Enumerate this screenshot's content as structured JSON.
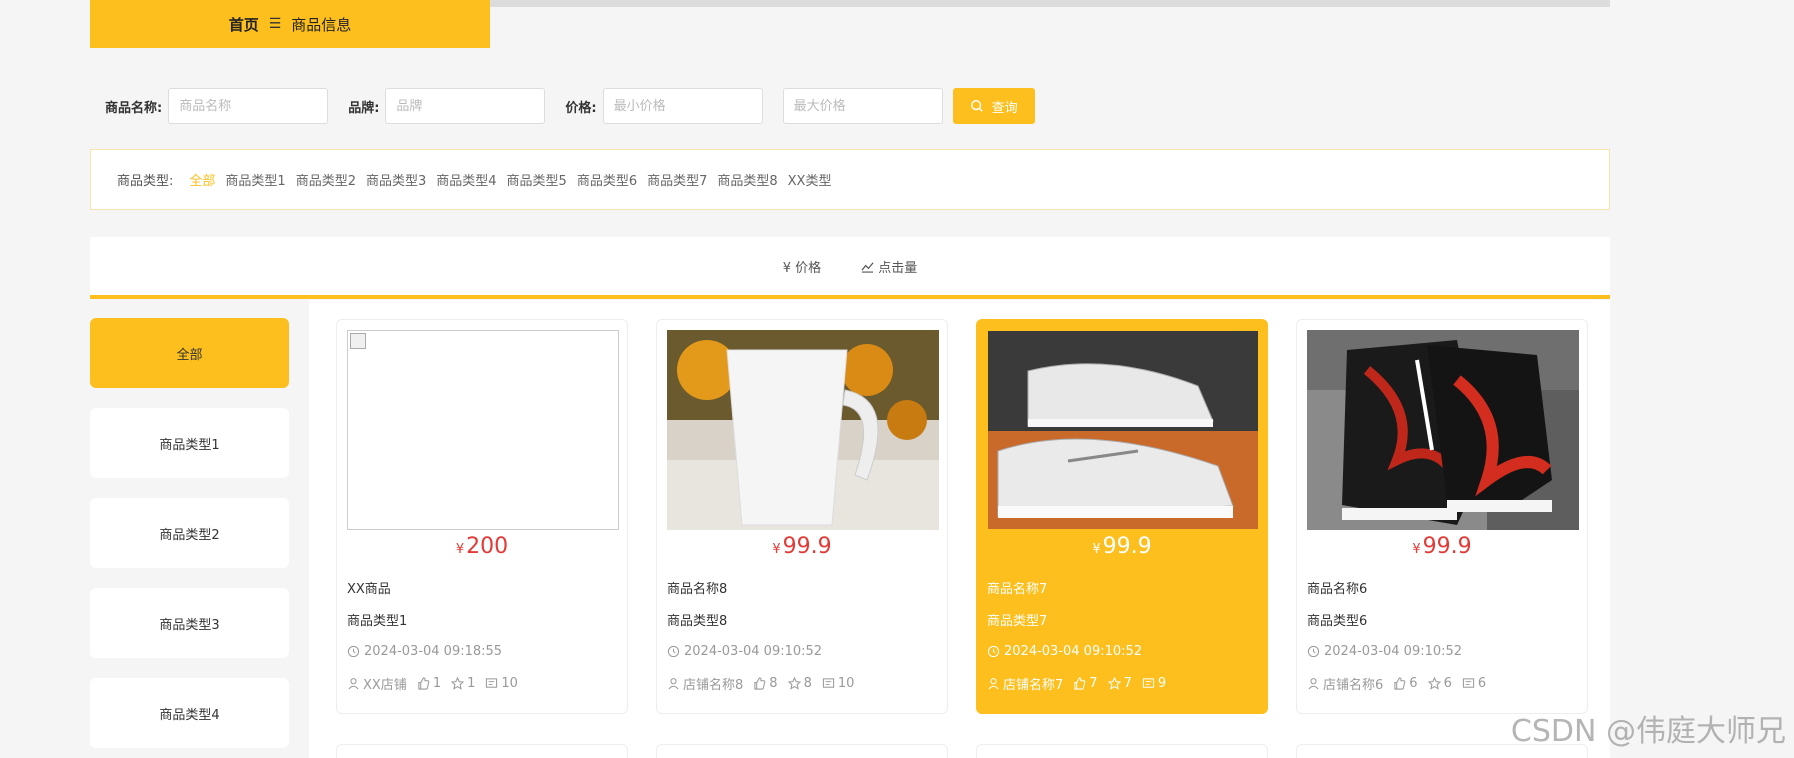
{
  "breadcrumb": {
    "home": "首页",
    "separator": "☰",
    "current": "商品信息"
  },
  "search": {
    "name_label": "商品名称:",
    "name_placeholder": "商品名称",
    "brand_label": "品牌:",
    "brand_placeholder": "品牌",
    "price_label": "价格:",
    "min_placeholder": "最小价格",
    "max_placeholder": "最大价格",
    "button_label": "查询"
  },
  "types": {
    "label": "商品类型:",
    "items": [
      "全部",
      "商品类型1",
      "商品类型2",
      "商品类型3",
      "商品类型4",
      "商品类型5",
      "商品类型6",
      "商品类型7",
      "商品类型8",
      "XX类型"
    ]
  },
  "sort": {
    "price": "¥ 价格",
    "clicks": "点击量"
  },
  "sidebar": {
    "items": [
      "全部",
      "商品类型1",
      "商品类型2",
      "商品类型3",
      "商品类型4"
    ]
  },
  "cards": [
    {
      "price_symbol": "¥",
      "price": "200",
      "name": "XX商品",
      "type": "商品类型1",
      "time": "2024-03-04 09:18:55",
      "shop": "XX店铺",
      "likes": "1",
      "favs": "1",
      "comments": "10"
    },
    {
      "price_symbol": "¥",
      "price": "99.9",
      "name": "商品名称8",
      "type": "商品类型8",
      "time": "2024-03-04 09:10:52",
      "shop": "店铺名称8",
      "likes": "8",
      "favs": "8",
      "comments": "10"
    },
    {
      "price_symbol": "¥",
      "price": "99.9",
      "name": "商品名称7",
      "type": "商品类型7",
      "time": "2024-03-04 09:10:52",
      "shop": "店铺名称7",
      "likes": "7",
      "favs": "7",
      "comments": "9"
    },
    {
      "price_symbol": "¥",
      "price": "99.9",
      "name": "商品名称6",
      "type": "商品类型6",
      "time": "2024-03-04 09:10:52",
      "shop": "店铺名称6",
      "likes": "6",
      "favs": "6",
      "comments": "6"
    }
  ],
  "watermark": "CSDN @伟庭大师兄",
  "colors": {
    "accent": "#fcbf1e",
    "price": "#e53935"
  }
}
